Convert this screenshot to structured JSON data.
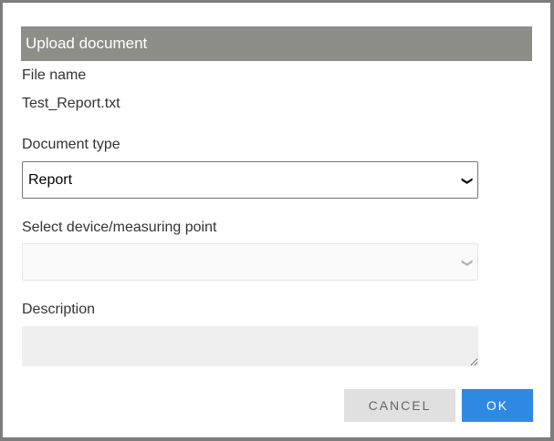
{
  "dialog": {
    "title": "Upload document",
    "file_name_label": "File name",
    "file_name": "Test_Report.txt",
    "doc_type_label": "Document type",
    "doc_type_value": "Report",
    "device_label": "Select device/measuring point",
    "device_value": "",
    "description_label": "Description",
    "description_value": "",
    "cancel_label": "CANCEL",
    "ok_label": "OK"
  }
}
